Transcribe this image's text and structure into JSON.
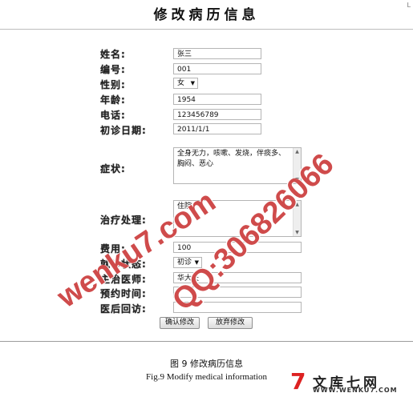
{
  "corner_mark": "L",
  "title": "修改病历信息",
  "form": {
    "name": {
      "label": "姓名:",
      "value": "张三"
    },
    "id": {
      "label": "编号:",
      "value": "001"
    },
    "gender": {
      "label": "性别:",
      "value": "女"
    },
    "age": {
      "label": "年龄:",
      "value": "1954"
    },
    "phone": {
      "label": "电话:",
      "value": "123456789"
    },
    "first_visit": {
      "label": "初诊日期:",
      "value": "2011/1/1"
    },
    "symptoms": {
      "label": "症状:",
      "value": "全身无力，咳嗽、发烧，伴痰多、胸闷、恶心"
    },
    "treatment": {
      "label": "治疗处理:",
      "value": "住院"
    },
    "cost": {
      "label": "费用:",
      "value": "100"
    },
    "status": {
      "label": "就诊状态:",
      "value": "初诊"
    },
    "doctor": {
      "label": "主治医师:",
      "value": "华大夫"
    },
    "appointment": {
      "label": "预约时间:",
      "value": ""
    },
    "followup": {
      "label": "医后回访:",
      "value": ""
    }
  },
  "buttons": {
    "confirm": "确认修改",
    "discard": "放弃修改"
  },
  "caption": {
    "cn": "图 9   修改病历信息",
    "en": "Fig.9 Modify medical information"
  },
  "watermarks": {
    "site": "wenku7.com",
    "qq": "QQ:306826066"
  },
  "logo": {
    "cn": "文库七网",
    "url": "WWW.WENKU7.COM"
  },
  "icons": {
    "dropdown": "chevron-down-icon",
    "scroll_up": "scroll-up-icon",
    "scroll_down": "scroll-down-icon"
  },
  "colors": {
    "watermark": "#c42323"
  }
}
